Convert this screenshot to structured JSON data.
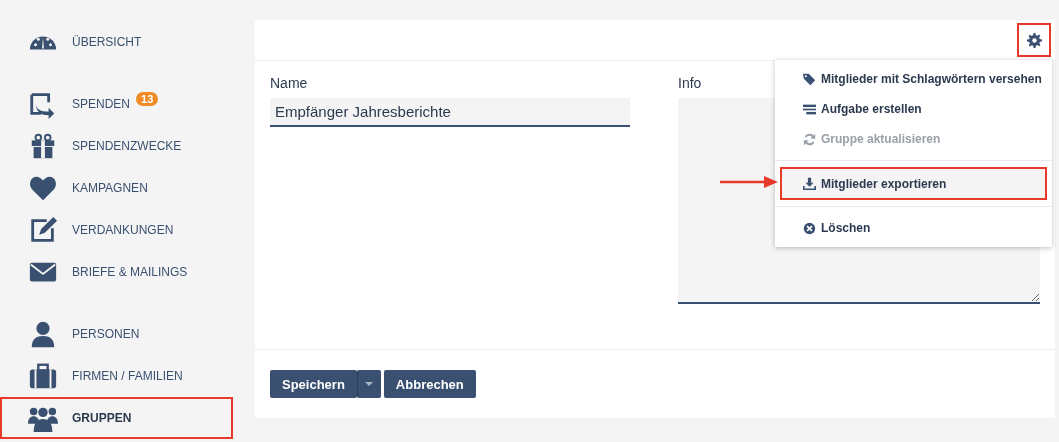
{
  "sidebar": {
    "groups": [
      [
        {
          "label": "ÜBERSICHT",
          "selected": false,
          "highlighted": false
        }
      ],
      [
        {
          "label": "SPENDEN",
          "badge": "13",
          "selected": false,
          "highlighted": false
        },
        {
          "label": "SPENDENZWECKE",
          "selected": false,
          "highlighted": false
        },
        {
          "label": "KAMPAGNEN",
          "selected": false,
          "highlighted": false
        },
        {
          "label": "VERDANKUNGEN",
          "selected": false,
          "highlighted": false
        },
        {
          "label": "BRIEFE & MAILINGS",
          "selected": false,
          "highlighted": false
        }
      ],
      [
        {
          "label": "PERSONEN",
          "selected": false,
          "highlighted": false
        },
        {
          "label": "FIRMEN / FAMILIEN",
          "selected": false,
          "highlighted": false
        },
        {
          "label": "GRUPPEN",
          "selected": true,
          "highlighted": true
        }
      ]
    ]
  },
  "form": {
    "name_label": "Name",
    "name_value": "Empfänger Jahresberichte",
    "info_label": "Info"
  },
  "settings_button": {
    "highlighted": true,
    "expanded": true
  },
  "menu": {
    "sections": [
      [
        {
          "label": "Mitglieder mit Schlagwörtern versehen",
          "disabled": false,
          "highlighted": false
        },
        {
          "label": "Aufgabe erstellen",
          "disabled": false,
          "highlighted": false
        },
        {
          "label": "Gruppe aktualisieren",
          "disabled": true,
          "highlighted": false
        }
      ],
      [
        {
          "label": "Mitglieder exportieren",
          "disabled": false,
          "highlighted": true
        }
      ],
      [
        {
          "label": "Löschen",
          "disabled": false,
          "highlighted": false
        }
      ]
    ]
  },
  "buttons": {
    "save": "Speichern",
    "cancel": "Abbrechen"
  }
}
